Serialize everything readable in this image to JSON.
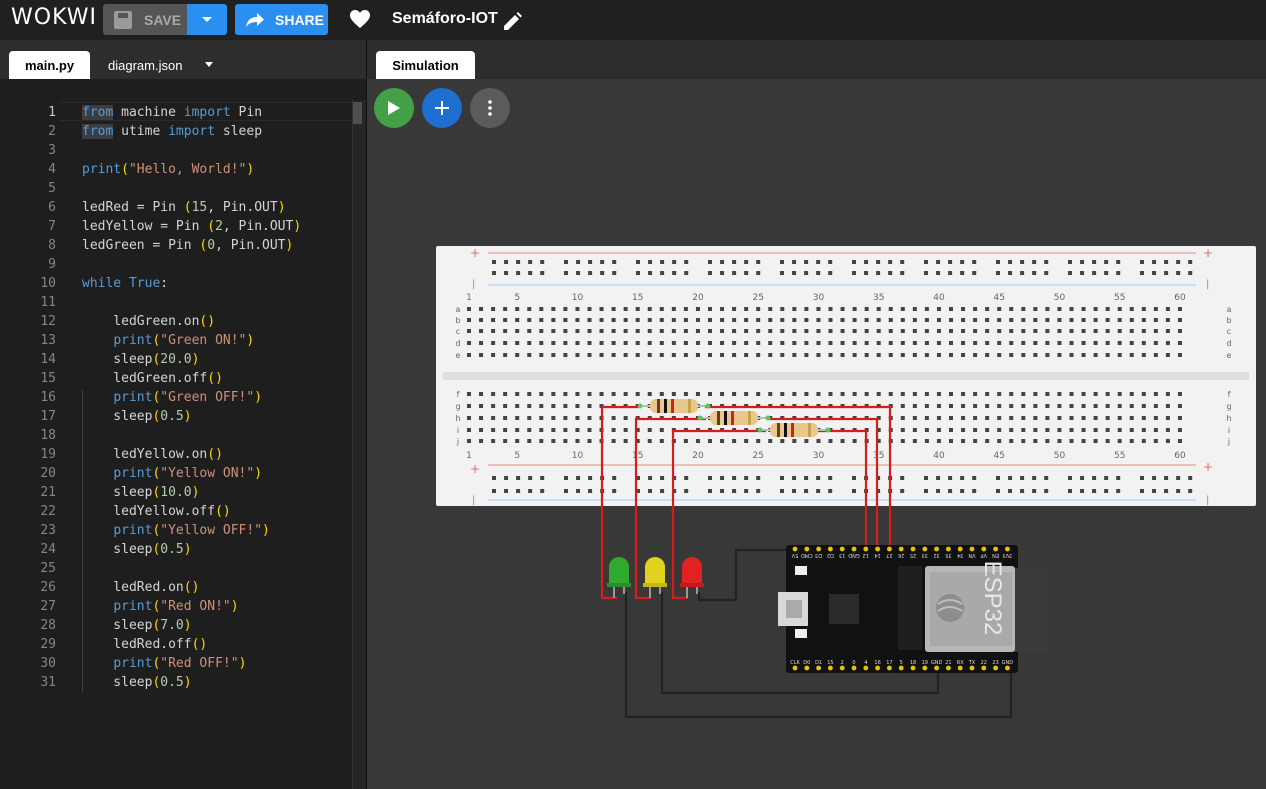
{
  "app": {
    "logo": "WOKWI",
    "save_label": "SAVE",
    "share_label": "SHARE",
    "project_title": "Semáforo-IOT"
  },
  "editor": {
    "tabs": [
      {
        "label": "main.py",
        "active": true
      },
      {
        "label": "diagram.json",
        "active": false
      }
    ],
    "code_lines": [
      "from machine import Pin",
      "from utime import sleep",
      "",
      "print(\"Hello, World!\")",
      "",
      "ledRed = Pin (15, Pin.OUT)",
      "ledYellow = Pin (2, Pin.OUT)",
      "ledGreen = Pin (0, Pin.OUT)",
      "",
      "while True:",
      "",
      "    ledGreen.on()",
      "    print(\"Green ON!\")",
      "    sleep(20.0)",
      "    ledGreen.off()",
      "    print(\"Green OFF!\")",
      "    sleep(0.5)",
      "",
      "    ledYellow.on()",
      "    print(\"Yellow ON!\")",
      "    sleep(10.0)",
      "    ledYellow.off()",
      "    print(\"Yellow OFF!\")",
      "    sleep(0.5)",
      "",
      "    ledRed.on()",
      "    print(\"Red ON!\")",
      "    sleep(7.0)",
      "    ledRed.off()",
      "    print(\"Red OFF!\")",
      "    sleep(0.5)"
    ]
  },
  "simulation": {
    "tab_label": "Simulation",
    "buttons": [
      {
        "name": "play-icon",
        "color": "#43a047"
      },
      {
        "name": "plus-icon",
        "color": "#1e6fd0"
      },
      {
        "name": "more-icon",
        "color": "#5b5b5b"
      }
    ],
    "breadboard": {
      "column_labels": [
        "1",
        "5",
        "10",
        "15",
        "20",
        "25",
        "30",
        "35",
        "40",
        "45",
        "50",
        "55",
        "60"
      ],
      "row_labels_top": [
        "a",
        "b",
        "c",
        "d",
        "e"
      ],
      "row_labels_bottom": [
        "f",
        "g",
        "h",
        "i",
        "j"
      ]
    },
    "leds": [
      {
        "color_name": "green",
        "color": "#2faa2f"
      },
      {
        "color_name": "yellow",
        "color": "#e2d21d"
      },
      {
        "color_name": "red",
        "color": "#e02222"
      }
    ],
    "esp32": {
      "chip_label": "ESP32",
      "bottom_pins": [
        "CLK",
        "D0",
        "D1",
        "15",
        "2",
        "0",
        "4",
        "16",
        "17",
        "5",
        "18",
        "19",
        "GND",
        "21",
        "RX",
        "TX",
        "22",
        "23",
        "GND"
      ],
      "top_pins": [
        "5V",
        "CMD",
        "D3",
        "D2",
        "13",
        "GND",
        "12",
        "14",
        "27",
        "26",
        "25",
        "33",
        "32",
        "35",
        "34",
        "VN",
        "VP",
        "EN",
        "3V3"
      ]
    },
    "wire_color": "#d81b1b"
  }
}
